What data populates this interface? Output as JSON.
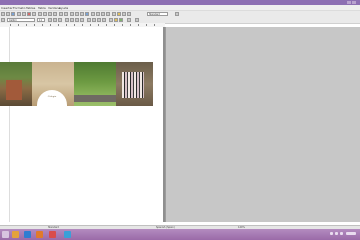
{
  "menu": {
    "items": [
      "Insertar",
      "Formato",
      "Tablas",
      "Tabla",
      "Ventana",
      "Ayuda"
    ]
  },
  "toolbar": {
    "font_name": "Calibri",
    "font_size": "11",
    "zoom": "Standard"
  },
  "statusbar": {
    "style": "Standard",
    "language": "Spanish (Spain)",
    "zoom": "120%"
  },
  "colors": {
    "taskbar": "#9a6aa8",
    "chrome": "#8d6fb3",
    "workspace": "#c7c7c7"
  },
  "banner_seal_text": "Colegio"
}
